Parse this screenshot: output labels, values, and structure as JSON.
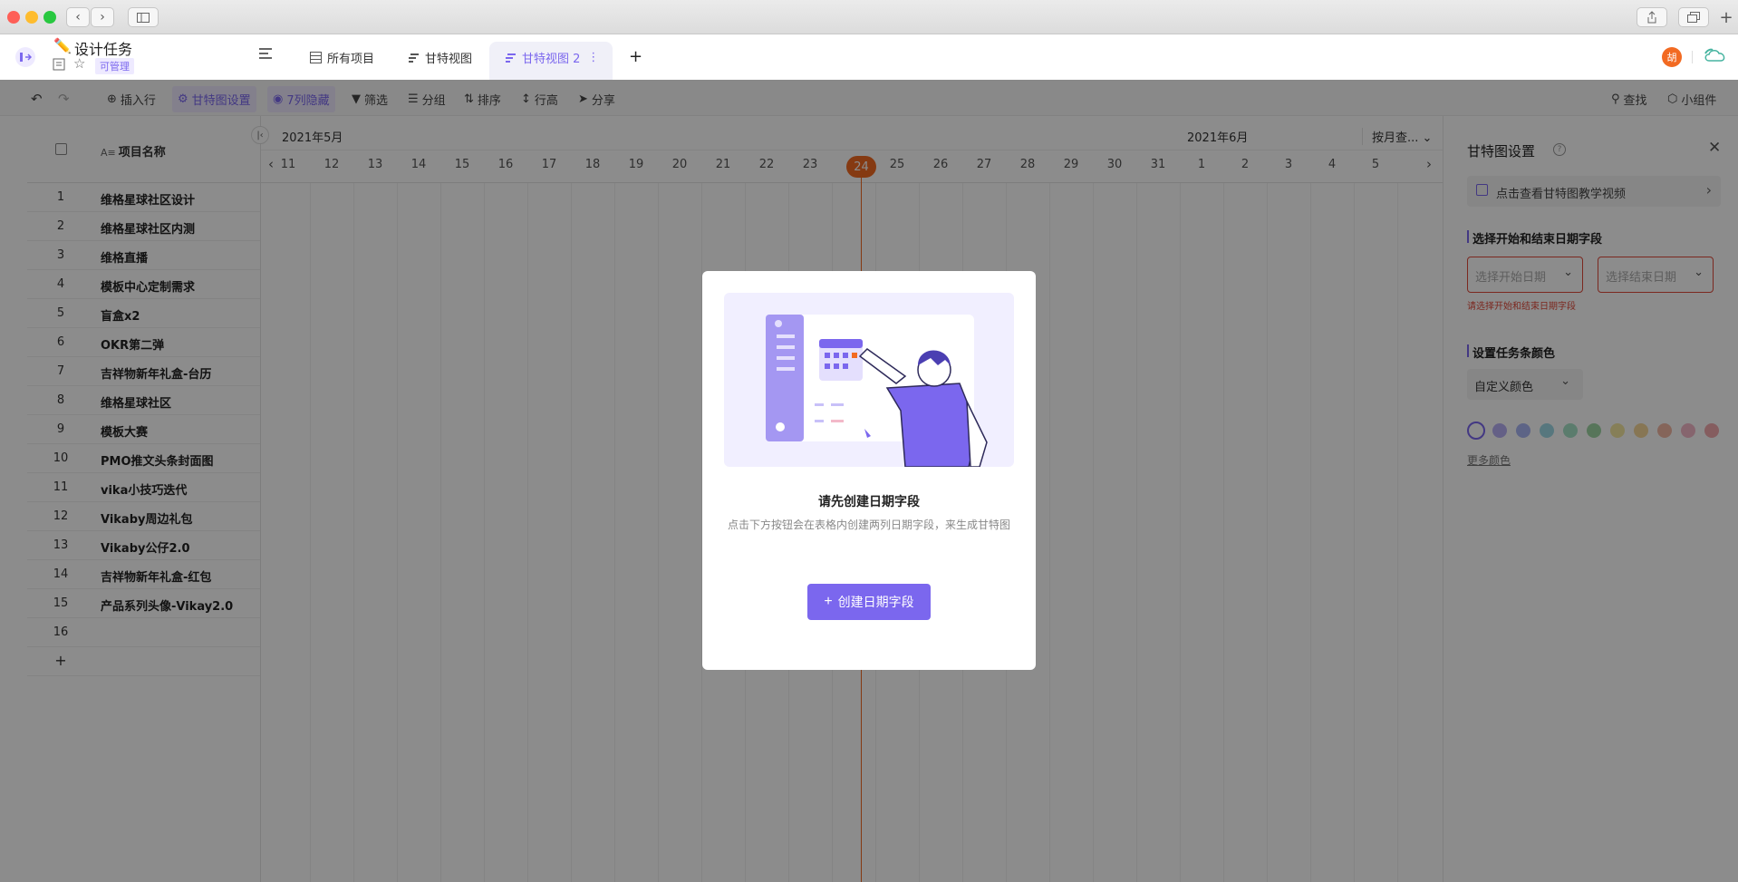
{
  "window": {
    "title": "设计任务"
  },
  "header": {
    "doc_title": "设计任务",
    "badge": "可管理",
    "tabs": [
      {
        "label": "所有项目"
      },
      {
        "label": "甘特视图"
      },
      {
        "label": "甘特视图 2"
      }
    ],
    "avatar": "胡",
    "accent": "#7b67ee"
  },
  "toolbar": {
    "insert_row": "插入行",
    "gantt_settings": "甘特图设置",
    "hidden_cols": "7列隐藏",
    "filter": "筛选",
    "group": "分组",
    "sort": "排序",
    "row_height": "行高",
    "share": "分享",
    "search": "查找",
    "widgets": "小组件"
  },
  "grid": {
    "column_header": "项目名称",
    "rows": [
      {
        "num": "1",
        "name": "维格星球社区设计"
      },
      {
        "num": "2",
        "name": "维格星球社区内测"
      },
      {
        "num": "3",
        "name": "维格直播"
      },
      {
        "num": "4",
        "name": "模板中心定制需求"
      },
      {
        "num": "5",
        "name": "盲盒x2"
      },
      {
        "num": "6",
        "name": "OKR第二弹"
      },
      {
        "num": "7",
        "name": "吉祥物新年礼盒-台历"
      },
      {
        "num": "8",
        "name": "维格星球社区"
      },
      {
        "num": "9",
        "name": "模板大赛"
      },
      {
        "num": "10",
        "name": "PMO推文头条封面图"
      },
      {
        "num": "11",
        "name": "vika小技巧迭代"
      },
      {
        "num": "12",
        "name": "Vikaby周边礼包"
      },
      {
        "num": "13",
        "name": "Vikaby公仔2.0"
      },
      {
        "num": "14",
        "name": "吉祥物新年礼盒-红包"
      },
      {
        "num": "15",
        "name": "产品系列头像-Vikay2.0"
      },
      {
        "num": "16",
        "name": ""
      }
    ]
  },
  "gantt": {
    "month_left": "2021年5月",
    "month_right": "2021年6月",
    "scale": "按月查...",
    "days": [
      "11",
      "12",
      "13",
      "14",
      "15",
      "16",
      "17",
      "18",
      "19",
      "20",
      "21",
      "22",
      "23",
      "24",
      "25",
      "26",
      "27",
      "28",
      "29",
      "30",
      "31",
      "1",
      "2",
      "3",
      "4",
      "5"
    ],
    "today": "24"
  },
  "panel": {
    "title": "甘特图设置",
    "tutorial": "点击查看甘特图教学视频",
    "date_section": "选择开始和结束日期字段",
    "start_placeholder": "选择开始日期",
    "end_placeholder": "选择结束日期",
    "date_error": "请选择开始和结束日期字段",
    "color_section": "设置任务条颜色",
    "color_select": "自定义颜色",
    "more_colors": "更多颜色",
    "swatches": [
      "#7b67ee",
      "#b7b0f5",
      "#aab6f4",
      "#9fd9e6",
      "#a6e2c7",
      "#9fd6a4",
      "#f4e7a1",
      "#f6d79a",
      "#f3b9a4",
      "#f4b8c9",
      "#f2a9ad"
    ]
  },
  "modal": {
    "title": "请先创建日期字段",
    "desc": "点击下方按钮会在表格内创建两列日期字段，来生成甘特图",
    "button": "创建日期字段"
  }
}
